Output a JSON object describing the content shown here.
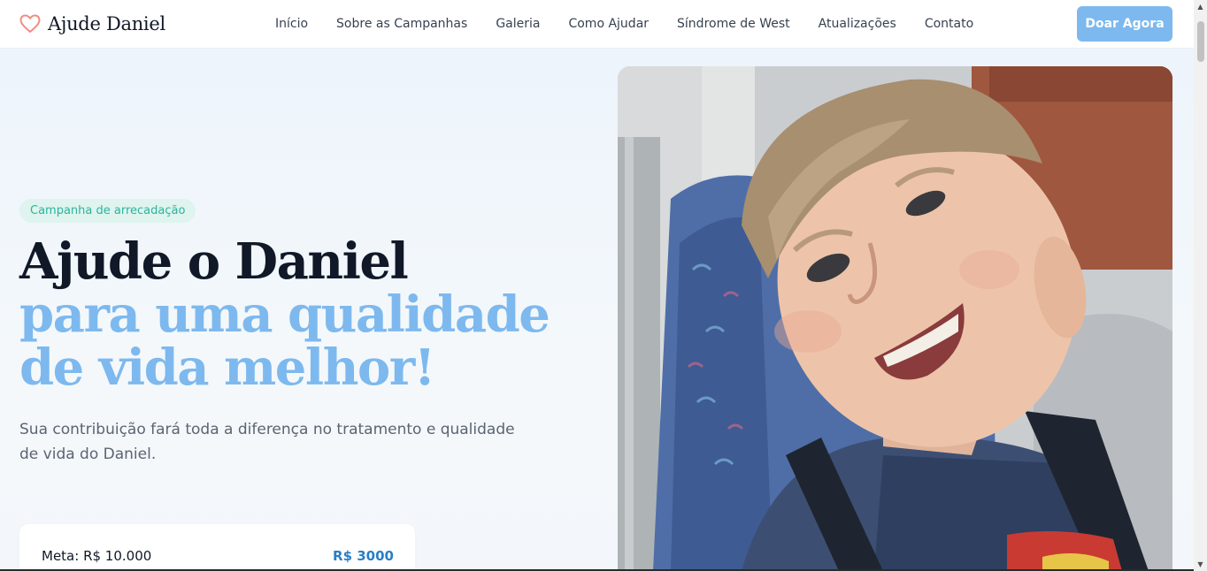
{
  "brand": {
    "name": "Ajude Daniel",
    "heart_color": "#f28b82"
  },
  "nav": {
    "items": [
      {
        "label": "Início"
      },
      {
        "label": "Sobre as Campanhas"
      },
      {
        "label": "Galeria"
      },
      {
        "label": "Como Ajudar"
      },
      {
        "label": "Síndrome de West"
      },
      {
        "label": "Atualizações"
      },
      {
        "label": "Contato"
      }
    ],
    "donate_label": "Doar Agora"
  },
  "hero": {
    "badge": "Campanha de arrecadação",
    "title_line1": "Ajude o Daniel",
    "title_line2": "para uma qualidade de vida melhor!",
    "subtitle": "Sua contribuição fará toda a diferença no tratamento e qualidade de vida do Daniel.",
    "goal": {
      "label": "Meta: R$ 10.000",
      "raised": "R$ 3000"
    }
  },
  "colors": {
    "accent": "#7db9ee",
    "badge_bg": "#dff3ef",
    "badge_text": "#2bb59a",
    "raised_text": "#2a7fc6"
  },
  "icons": {
    "logo": "heart-icon",
    "scroll_up": "arrow-up-icon",
    "scroll_down": "arrow-down-icon"
  }
}
